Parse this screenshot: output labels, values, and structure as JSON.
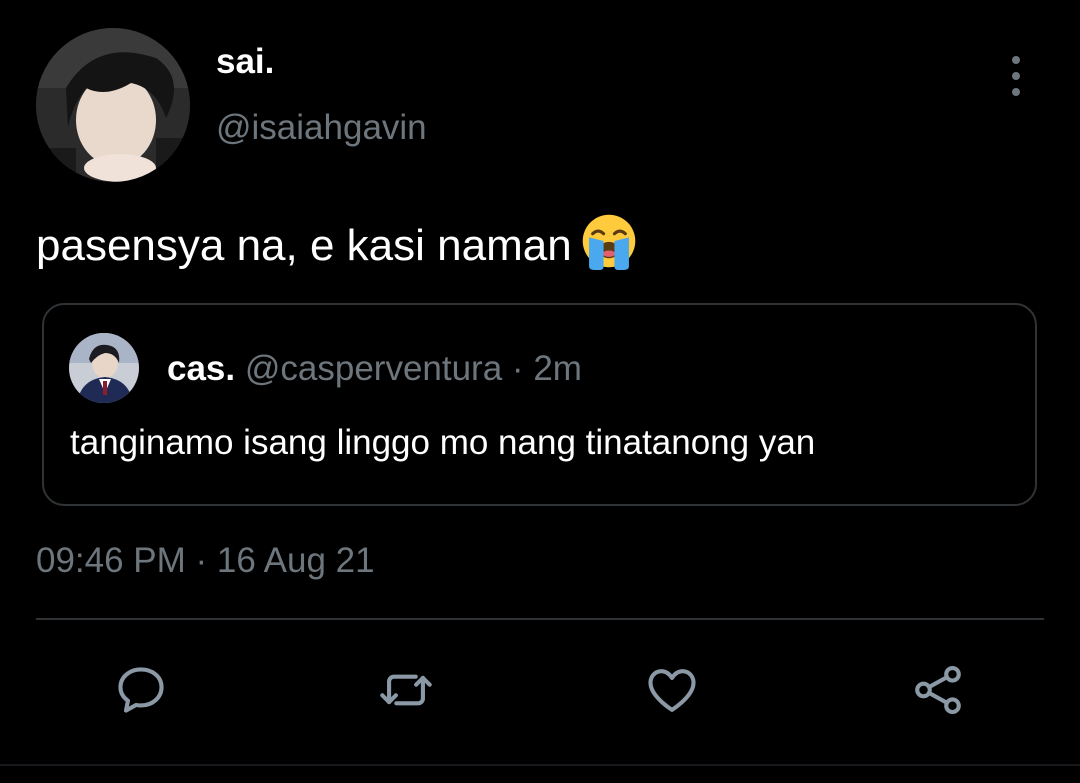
{
  "author": {
    "display_name": "sai.",
    "handle": "@isaiahgavin"
  },
  "tweet": {
    "text": "pasensya na, e kasi naman",
    "emoji": "loudly-crying-face-emoji",
    "timestamp": "09:46 PM · 16 Aug 21"
  },
  "quoted_tweet": {
    "display_name": "cas.",
    "handle": "@casperventura",
    "separator": "·",
    "time": "2m",
    "text": "tanginamo isang linggo mo nang tinatanong yan"
  },
  "actions": [
    {
      "name": "reply",
      "icon": "speech-bubble-icon"
    },
    {
      "name": "retweet",
      "icon": "retweet-arrows-icon"
    },
    {
      "name": "like",
      "icon": "heart-icon"
    },
    {
      "name": "share",
      "icon": "share-nodes-icon"
    }
  ],
  "colors": {
    "background": "#000000",
    "primary_text": "#ffffff",
    "secondary_text": "#6e767d",
    "border": "#2f3336"
  }
}
